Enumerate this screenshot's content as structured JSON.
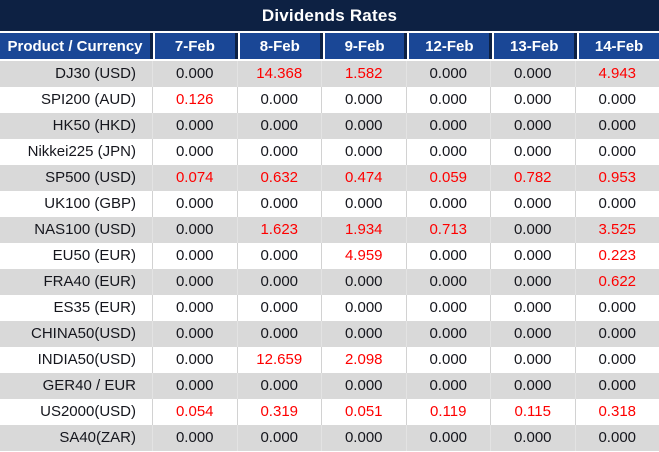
{
  "title": "Dividends Rates",
  "table": {
    "product_header": "Product / Currency",
    "date_headers": [
      "7-Feb",
      "8-Feb",
      "9-Feb",
      "12-Feb",
      "13-Feb",
      "14-Feb"
    ],
    "rows": [
      {
        "product": "DJ30 (USD)",
        "values": [
          "0.000",
          "14.368",
          "1.582",
          "0.000",
          "0.000",
          "4.943"
        ]
      },
      {
        "product": "SPI200 (AUD)",
        "values": [
          "0.126",
          "0.000",
          "0.000",
          "0.000",
          "0.000",
          "0.000"
        ]
      },
      {
        "product": "HK50 (HKD)",
        "values": [
          "0.000",
          "0.000",
          "0.000",
          "0.000",
          "0.000",
          "0.000"
        ]
      },
      {
        "product": "Nikkei225 (JPN)",
        "values": [
          "0.000",
          "0.000",
          "0.000",
          "0.000",
          "0.000",
          "0.000"
        ]
      },
      {
        "product": "SP500 (USD)",
        "values": [
          "0.074",
          "0.632",
          "0.474",
          "0.059",
          "0.782",
          "0.953"
        ]
      },
      {
        "product": "UK100 (GBP)",
        "values": [
          "0.000",
          "0.000",
          "0.000",
          "0.000",
          "0.000",
          "0.000"
        ]
      },
      {
        "product": "NAS100 (USD)",
        "values": [
          "0.000",
          "1.623",
          "1.934",
          "0.713",
          "0.000",
          "3.525"
        ]
      },
      {
        "product": "EU50 (EUR)",
        "values": [
          "0.000",
          "0.000",
          "4.959",
          "0.000",
          "0.000",
          "0.223"
        ]
      },
      {
        "product": "FRA40 (EUR)",
        "values": [
          "0.000",
          "0.000",
          "0.000",
          "0.000",
          "0.000",
          "0.622"
        ]
      },
      {
        "product": "ES35 (EUR)",
        "values": [
          "0.000",
          "0.000",
          "0.000",
          "0.000",
          "0.000",
          "0.000"
        ]
      },
      {
        "product": "CHINA50(USD)",
        "values": [
          "0.000",
          "0.000",
          "0.000",
          "0.000",
          "0.000",
          "0.000"
        ]
      },
      {
        "product": "INDIA50(USD)",
        "values": [
          "0.000",
          "12.659",
          "2.098",
          "0.000",
          "0.000",
          "0.000"
        ]
      },
      {
        "product": "GER40 / EUR",
        "values": [
          "0.000",
          "0.000",
          "0.000",
          "0.000",
          "0.000",
          "0.000"
        ]
      },
      {
        "product": "US2000(USD)",
        "values": [
          "0.054",
          "0.319",
          "0.051",
          "0.119",
          "0.115",
          "0.318"
        ]
      },
      {
        "product": "SA40(ZAR)",
        "values": [
          "0.000",
          "0.000",
          "0.000",
          "0.000",
          "0.000",
          "0.000"
        ]
      }
    ]
  },
  "colors": {
    "title_bar": "#0d2143",
    "header_blue": "#1a4796",
    "row_gray": "#d9d9d9",
    "text": "#15161d",
    "highlight_red": "#fe0000",
    "border_white": "#ffffff"
  }
}
